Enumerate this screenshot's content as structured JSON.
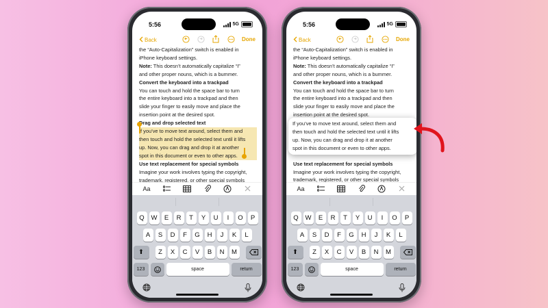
{
  "colors": {
    "accent": "#e6a600",
    "highlight": "#f6e7b2",
    "arrow": "#e0141d"
  },
  "status": {
    "time": "5:56",
    "network": "5G"
  },
  "nav": {
    "back_label": "Back",
    "done_label": "Done",
    "icons": [
      "chevron-left-icon",
      "undo-icon",
      "redo-icon",
      "share-icon",
      "more-icon"
    ]
  },
  "note": {
    "lines_before": [
      {
        "text": "the “Auto-Capitalization” switch is enabled in",
        "bold": false
      },
      {
        "text": "iPhone keyboard settings.",
        "bold": false
      }
    ],
    "note_label": "Note:",
    "note_line1": " This doesn’t automatically capitalize “I”",
    "note_line2": "and other proper nouns, which is a bummer.",
    "heading_trackpad": "Convert the keyboard into a trackpad",
    "trackpad_lines": [
      "You can touch and hold the space bar to turn",
      "the entire keyboard into a trackpad and then",
      "slide your finger to easily move and place the",
      "insertion point at the desired spot."
    ],
    "heading_drag": "Drag and drop selected text",
    "drag_lines": [
      "If you’ve to move text around, select them and",
      "then touch and hold the selected text until it lifts",
      "up. Now, you can drag and drop it at another",
      "spot in this document or even to other apps."
    ],
    "heading_replace": "Use text replacement for special symbols",
    "replace_lines": [
      "Imagine your work involves typing the copyright,",
      "trademark, registered, or other special symbols"
    ]
  },
  "toolbar": {
    "format_label": "Aa",
    "icons": [
      "checklist-icon",
      "table-icon",
      "attachment-icon",
      "markup-icon",
      "close-icon"
    ]
  },
  "keyboard": {
    "row1": [
      "Q",
      "W",
      "E",
      "R",
      "T",
      "Y",
      "U",
      "I",
      "O",
      "P"
    ],
    "row2": [
      "A",
      "S",
      "D",
      "F",
      "G",
      "H",
      "J",
      "K",
      "L"
    ],
    "row3": [
      "Z",
      "X",
      "C",
      "V",
      "B",
      "N",
      "M"
    ],
    "numbers_label": "123",
    "space_label": "space",
    "return_label": "return"
  }
}
